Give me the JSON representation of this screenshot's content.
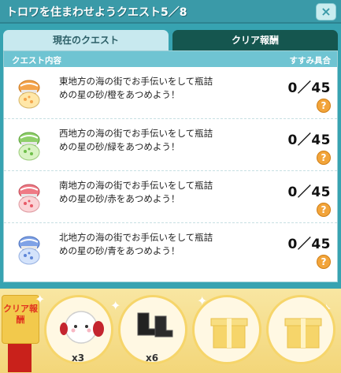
{
  "window": {
    "title": "トロワを住まわせようクエスト5／8",
    "close_label": "×"
  },
  "tabs": [
    {
      "label": "現在のクエスト",
      "active": true
    },
    {
      "label": "クリア報酬",
      "active": false
    }
  ],
  "quest_list": {
    "header_left": "クエスト内容",
    "header_right": "すすみ具合",
    "help_label": "?",
    "items": [
      {
        "description": "東地方の海の街でお手伝いをして瓶詰めの星の砂/橙をあつめよう！",
        "progress": "0／45",
        "icon": "orange-star-sand-jar-icon",
        "color": "#f4a44b"
      },
      {
        "description": "西地方の海の街でお手伝いをして瓶詰めの星の砂/緑をあつめよう！",
        "progress": "0／45",
        "icon": "green-star-sand-jar-icon",
        "color": "#8fcf6a"
      },
      {
        "description": "南地方の海の街でお手伝いをして瓶詰めの星の砂/赤をあつめよう！",
        "progress": "0／45",
        "icon": "red-star-sand-jar-icon",
        "color": "#ef7a85"
      },
      {
        "description": "北地方の海の街でお手伝いをして瓶詰めの星の砂/青をあつめよう！",
        "progress": "0／45",
        "icon": "blue-star-sand-jar-icon",
        "color": "#7fa2e6"
      }
    ]
  },
  "rewards": {
    "label": "クリア報酬",
    "items": [
      {
        "icon": "white-creature-earmuffs-icon",
        "count": "x3"
      },
      {
        "icon": "black-boots-icon",
        "count": "x6"
      },
      {
        "icon": "gift-box-icon",
        "count": ""
      },
      {
        "icon": "gift-box-icon",
        "count": ""
      }
    ]
  }
}
